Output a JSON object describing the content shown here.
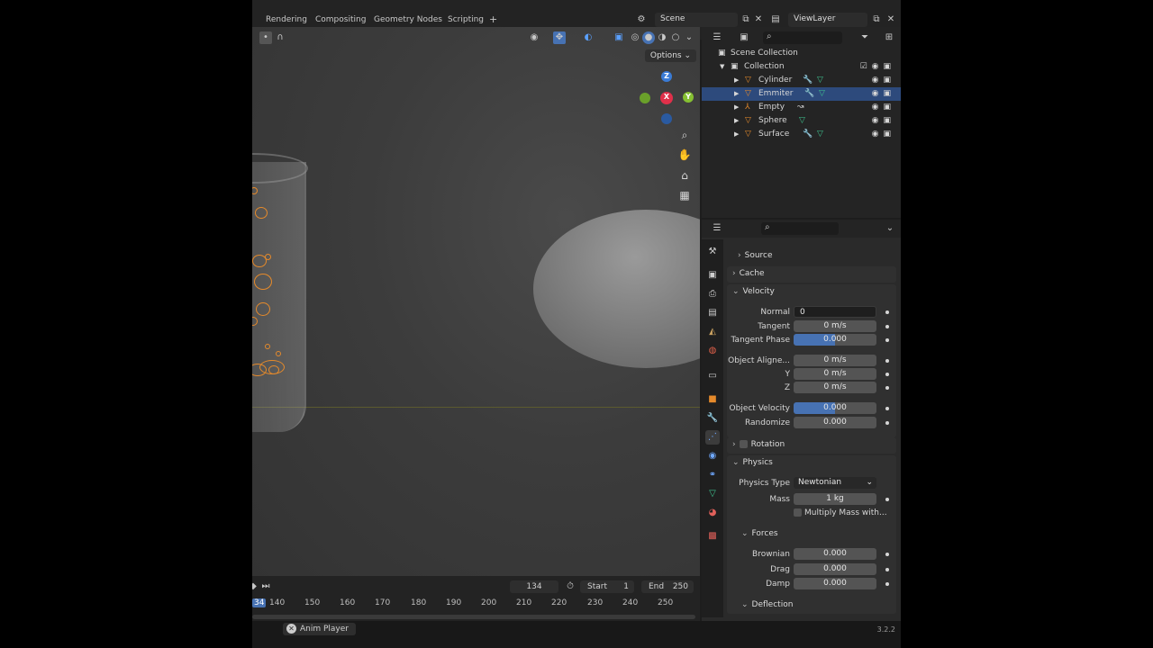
{
  "topbar": {
    "tabs": [
      "Rendering",
      "Compositing",
      "Geometry Nodes",
      "Scripting",
      "+"
    ],
    "scene_label": "Scene",
    "viewlayer_label": "ViewLayer"
  },
  "viewport": {
    "options_label": "Options",
    "gizmo": {
      "z": "Z",
      "x": "X",
      "y": "Y"
    }
  },
  "timeline": {
    "current_frame": "134",
    "start_label": "Start",
    "start_value": "1",
    "end_label": "End",
    "end_value": "250",
    "frame_ticks": [
      "34",
      "140",
      "150",
      "160",
      "170",
      "180",
      "190",
      "200",
      "210",
      "220",
      "230",
      "240",
      "250"
    ]
  },
  "statusbar": {
    "anim_player": "Anim Player",
    "version": "3.2.2"
  },
  "outliner": {
    "scene_collection": "Scene Collection",
    "collection": "Collection",
    "items": [
      {
        "label": "Cylinder",
        "selected": false
      },
      {
        "label": "Emmiter",
        "selected": true
      },
      {
        "label": "Empty",
        "selected": false
      },
      {
        "label": "Sphere",
        "selected": false
      },
      {
        "label": "Surface",
        "selected": false
      }
    ]
  },
  "properties": {
    "source": "Source",
    "cache": "Cache",
    "velocity": {
      "title": "Velocity",
      "normal_label": "Normal",
      "normal_value": "0",
      "tangent_label": "Tangent",
      "tangent_value": "0 m/s",
      "tangent_phase_label": "Tangent Phase",
      "tangent_phase_value": "0.000",
      "object_aligned_label": "Object Aligne...",
      "object_aligned_value": "0 m/s",
      "y_label": "Y",
      "y_value": "0 m/s",
      "z_label": "Z",
      "z_value": "0 m/s",
      "object_velocity_label": "Object Velocity",
      "object_velocity_value": "0.000",
      "randomize_label": "Randomize",
      "randomize_value": "0.000"
    },
    "rotation": "Rotation",
    "physics": {
      "title": "Physics",
      "physics_type_label": "Physics Type",
      "physics_type_value": "Newtonian",
      "mass_label": "Mass",
      "mass_value": "1 kg",
      "multiply_mass_label": "Multiply Mass with..."
    },
    "forces": {
      "title": "Forces",
      "brownian_label": "Brownian",
      "brownian_value": "0.000",
      "drag_label": "Drag",
      "drag_value": "0.000",
      "damp_label": "Damp",
      "damp_value": "0.000"
    },
    "deflection": "Deflection"
  },
  "colors": {
    "accent_blue": "#4772b3",
    "selected_row": "#2d4a7c",
    "bubble_orange": "#e58a2b"
  }
}
